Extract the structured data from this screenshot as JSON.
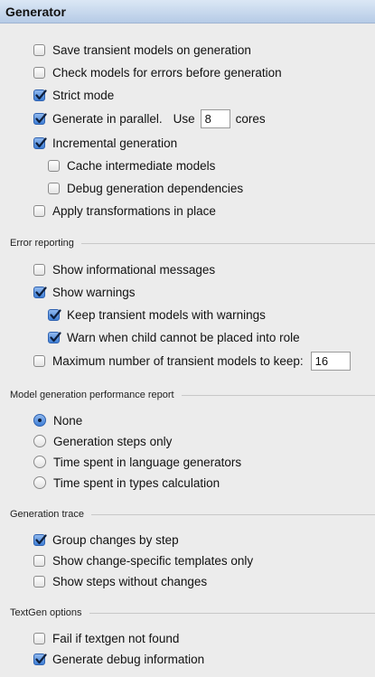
{
  "panel": {
    "title": "Generator"
  },
  "generator": {
    "save_transient": {
      "label": "Save transient models on generation",
      "checked": false
    },
    "check_models": {
      "label": "Check models for errors before generation",
      "checked": false
    },
    "strict_mode": {
      "label": "Strict mode",
      "checked": true
    },
    "parallel": {
      "label": "Generate in parallel.",
      "use_label": "Use",
      "cores_value": "8",
      "cores_label": "cores",
      "checked": true
    },
    "incremental": {
      "label": "Incremental generation",
      "checked": true
    },
    "cache_intermediate": {
      "label": "Cache intermediate models",
      "checked": false
    },
    "debug_deps": {
      "label": "Debug generation dependencies",
      "checked": false
    },
    "apply_in_place": {
      "label": "Apply transformations in place",
      "checked": false
    }
  },
  "error_reporting": {
    "title": "Error reporting",
    "show_info": {
      "label": "Show informational messages",
      "checked": false
    },
    "show_warnings": {
      "label": "Show warnings",
      "checked": true
    },
    "keep_transient": {
      "label": "Keep transient models with warnings",
      "checked": true
    },
    "warn_child": {
      "label": "Warn when child cannot be placed into role",
      "checked": true
    },
    "max_transient": {
      "label": "Maximum number of transient models to keep:",
      "value": "16",
      "checked": false
    }
  },
  "performance_report": {
    "title": "Model generation performance report",
    "options": [
      {
        "label": "None",
        "selected": true
      },
      {
        "label": "Generation steps only",
        "selected": false
      },
      {
        "label": "Time spent in language generators",
        "selected": false
      },
      {
        "label": "Time spent in types calculation",
        "selected": false
      }
    ]
  },
  "generation_trace": {
    "title": "Generation trace",
    "group_changes": {
      "label": "Group changes by step",
      "checked": true
    },
    "change_specific": {
      "label": "Show change-specific templates only",
      "checked": false
    },
    "steps_without_changes": {
      "label": "Show steps without changes",
      "checked": false
    }
  },
  "textgen": {
    "title": "TextGen options",
    "fail_if_not_found": {
      "label": "Fail if textgen not found",
      "checked": false
    },
    "debug_info": {
      "label": "Generate debug information",
      "checked": true
    }
  }
}
